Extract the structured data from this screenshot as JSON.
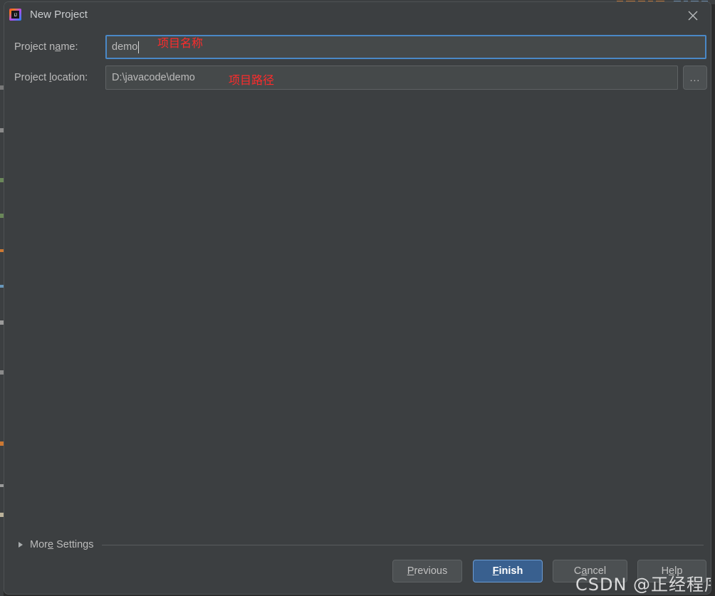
{
  "window": {
    "title": "New Project",
    "app_icon": "intellij-idea-icon",
    "icon_text": "IJ",
    "close_icon": "close-icon"
  },
  "form": {
    "name_field": {
      "label_before": "Project n",
      "label_mnemonic": "a",
      "label_after": "me:",
      "label_full": "Project name:",
      "value": "demo"
    },
    "location_field": {
      "label_before": "Project ",
      "label_mnemonic": "l",
      "label_after": "ocation:",
      "label_full": "Project location:",
      "value": "D:\\javacode\\demo"
    },
    "browse_button_label": "..."
  },
  "annotations": [
    {
      "text": "项目名称",
      "meaning": "project-name",
      "color": "#ff2b2b"
    },
    {
      "text": "项目路径",
      "meaning": "project-path",
      "color": "#ff2b2b"
    }
  ],
  "more_settings": {
    "before": "Mor",
    "mnemonic": "e",
    "after": " Settings",
    "full": "More Settings",
    "expanded": false,
    "chevron_icon": "chevron-right-icon"
  },
  "buttons": [
    {
      "id": "previous",
      "before": "",
      "mnemonic": "P",
      "after": "revious",
      "label": "Previous",
      "style": "secondary"
    },
    {
      "id": "finish",
      "before": "",
      "mnemonic": "F",
      "after": "inish",
      "label": "Finish",
      "style": "primary"
    },
    {
      "id": "cancel",
      "before": "C",
      "mnemonic": "a",
      "after": "ncel",
      "label": "Cancel",
      "style": "secondary"
    },
    {
      "id": "help",
      "before": "H",
      "mnemonic": "e",
      "after": "lp",
      "label": "Help",
      "style": "secondary"
    }
  ],
  "watermark": {
    "text": "CSDN @正经程序猿"
  },
  "colors": {
    "dialog_background": "#3c3f41",
    "field_background": "#45494a",
    "focus_border": "#4a88c7",
    "primary_button": "#39608f",
    "primary_button_border": "#6b9bd2",
    "secondary_button": "#4c5052",
    "text": "#bbbbbb",
    "annotation_red": "#ff2b2b"
  }
}
